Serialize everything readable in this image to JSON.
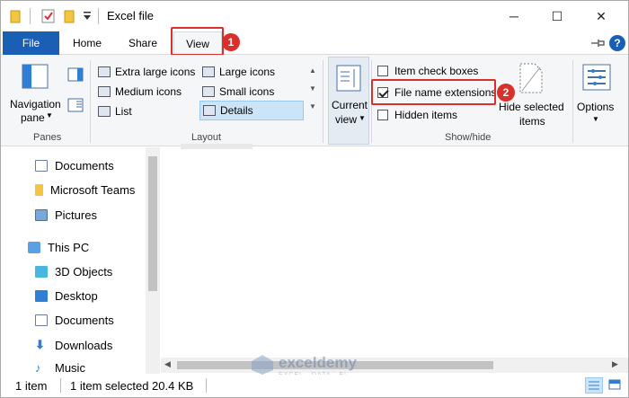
{
  "window": {
    "title": "Excel file",
    "controls": {
      "minimize": "─",
      "maximize": "☐",
      "close": "✕"
    }
  },
  "tabs": [
    {
      "label": "File"
    },
    {
      "label": "Home"
    },
    {
      "label": "Share"
    },
    {
      "label": "View"
    }
  ],
  "ribbon": {
    "panes": {
      "navigation_pane": "Navigation",
      "navigation_pane2": "pane",
      "group_label": "Panes"
    },
    "layout": {
      "items": [
        "Extra large icons",
        "Large icons",
        "Medium icons",
        "Small icons",
        "List",
        "Details"
      ],
      "group_label": "Layout"
    },
    "current_view": {
      "line1": "Current",
      "line2": "view"
    },
    "show_hide": {
      "item_check_boxes": "Item check boxes",
      "file_name_extensions": "File name extensions",
      "hidden_items": "Hidden items",
      "hide_selected_1": "Hide selected",
      "hide_selected_2": "items",
      "group_label": "Show/hide",
      "checked": {
        "item_check_boxes": false,
        "file_name_extensions": true,
        "hidden_items": false
      }
    },
    "options": {
      "label": "Options"
    }
  },
  "annotations": {
    "step1": "1",
    "step2": "2"
  },
  "nav_pane": {
    "items": [
      "Documents",
      "Microsoft Teams",
      "Pictures",
      "This PC",
      "3D Objects",
      "Desktop",
      "Documents",
      "Downloads",
      "Music"
    ]
  },
  "status": {
    "count": "1 item",
    "selection": "1 item selected  20.4 KB"
  },
  "watermark": {
    "name": "exceldemy",
    "tagline": "EXCEL · DATA · BI"
  },
  "colors": {
    "accent": "#1a5fb4",
    "highlight": "#d9302c",
    "folder": "#f4c542"
  }
}
